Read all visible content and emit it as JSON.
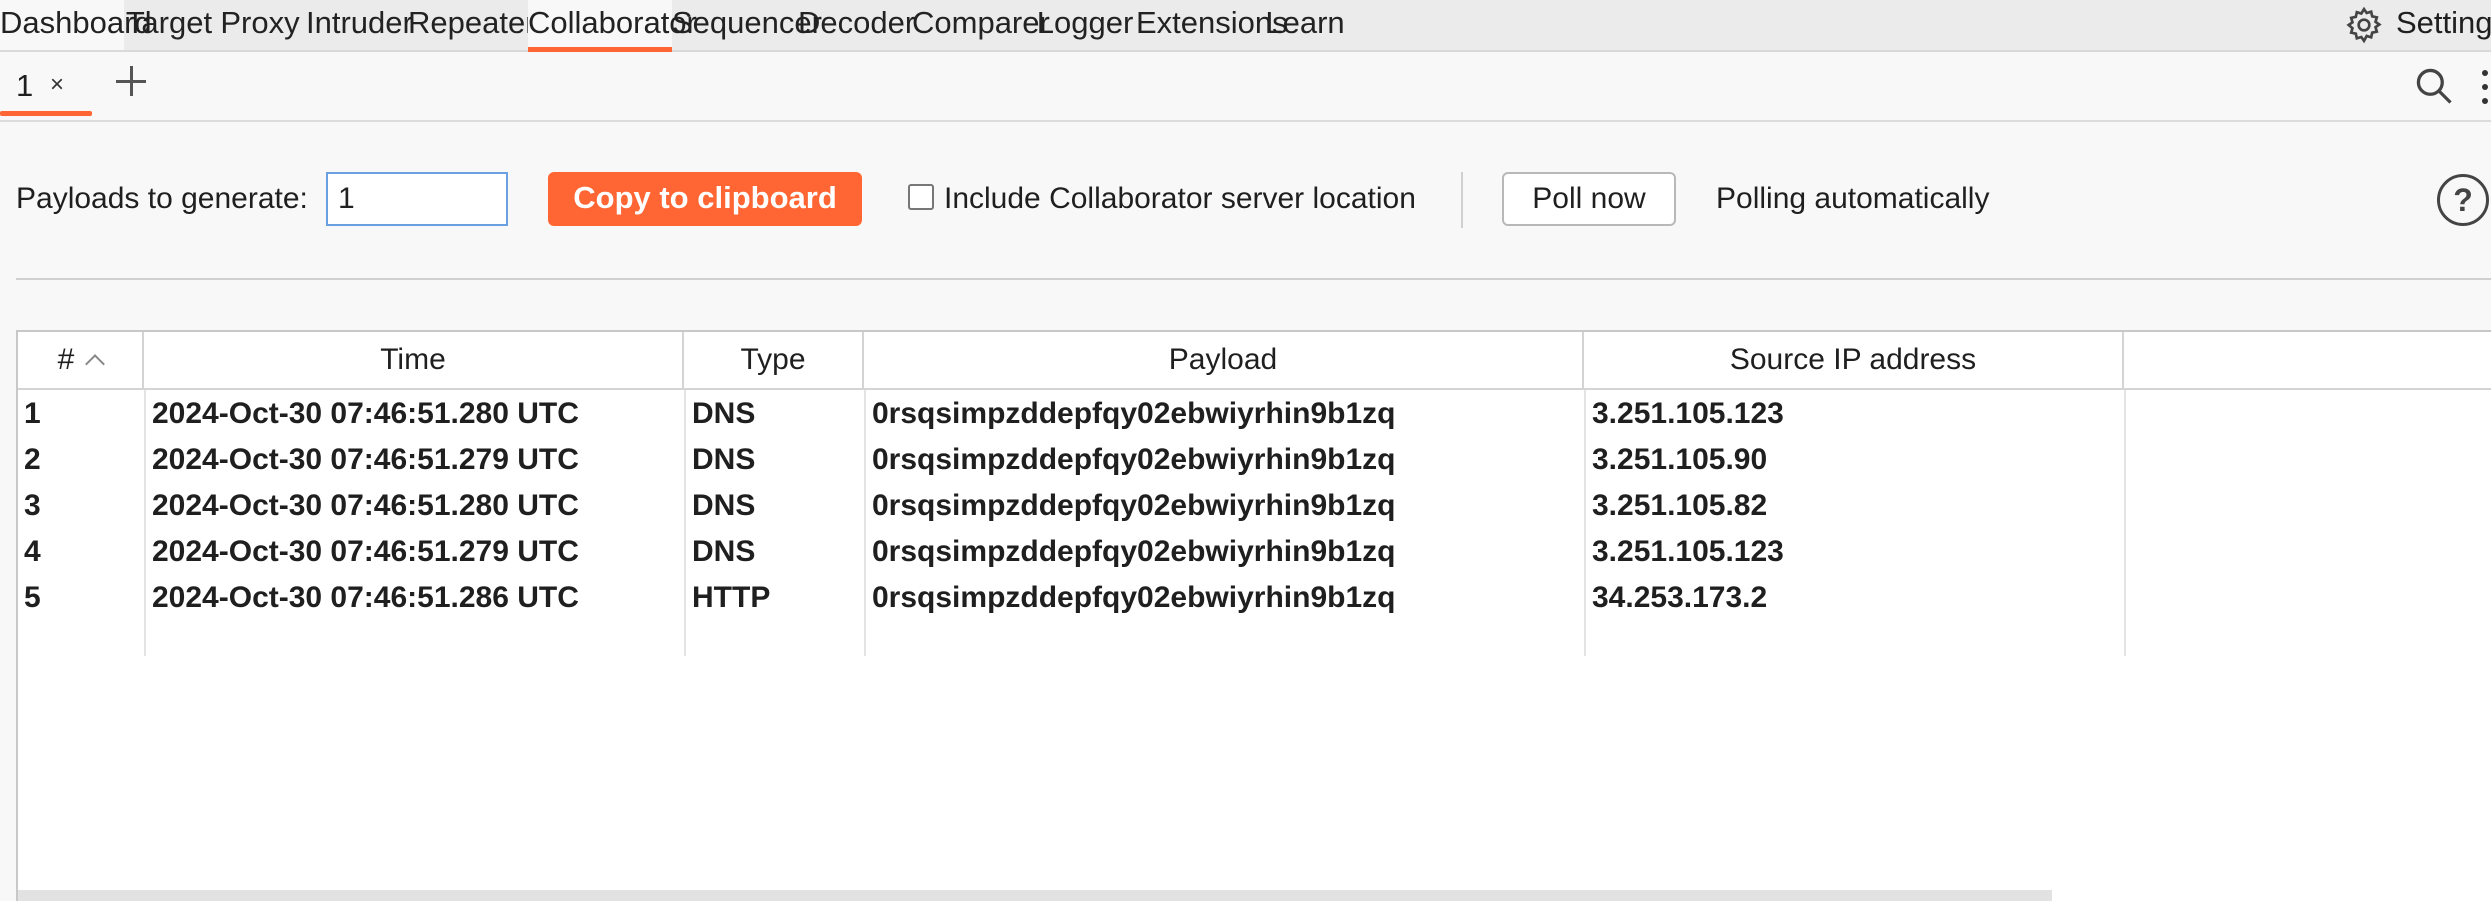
{
  "top_tabs": [
    "Dashboard",
    "Target",
    "Proxy",
    "Intruder",
    "Repeater",
    "Collaborator",
    "Sequencer",
    "Decoder",
    "Comparer",
    "Logger",
    "Extensions",
    "Learn"
  ],
  "active_top_tab": "Collaborator",
  "settings_label": "Settings",
  "sub_tab": {
    "label": "1",
    "close": "×"
  },
  "controls": {
    "payloads_label": "Payloads to generate:",
    "payloads_value": "1",
    "copy_button": "Copy to clipboard",
    "include_location_label": "Include Collaborator server location",
    "include_location_checked": false,
    "poll_button": "Poll now",
    "polling_status": "Polling automatically",
    "help": "?"
  },
  "table": {
    "columns": [
      "#",
      "Time",
      "Type",
      "Payload",
      "Source IP address"
    ],
    "rows": [
      [
        "1",
        "2024-Oct-30 07:46:51.280 UTC",
        "DNS",
        "0rsqsimpzddepfqy02ebwiyrhin9b1zq",
        "3.251.105.123"
      ],
      [
        "2",
        "2024-Oct-30 07:46:51.279 UTC",
        "DNS",
        "0rsqsimpzddepfqy02ebwiyrhin9b1zq",
        "3.251.105.90"
      ],
      [
        "3",
        "2024-Oct-30 07:46:51.280 UTC",
        "DNS",
        "0rsqsimpzddepfqy02ebwiyrhin9b1zq",
        "3.251.105.82"
      ],
      [
        "4",
        "2024-Oct-30 07:46:51.279 UTC",
        "DNS",
        "0rsqsimpzddepfqy02ebwiyrhin9b1zq",
        "3.251.105.123"
      ],
      [
        "5",
        "2024-Oct-30 07:46:51.286 UTC",
        "HTTP",
        "0rsqsimpzddepfqy02ebwiyrhin9b1zq",
        "34.253.173.2"
      ]
    ]
  },
  "colors": {
    "accent": "#ff6633",
    "input_border": "#6a9fe0"
  },
  "icons": {
    "settings": "gear-icon",
    "search": "search-icon",
    "more": "more-vertical-icon",
    "add": "plus-icon",
    "help": "help-circle-icon"
  }
}
